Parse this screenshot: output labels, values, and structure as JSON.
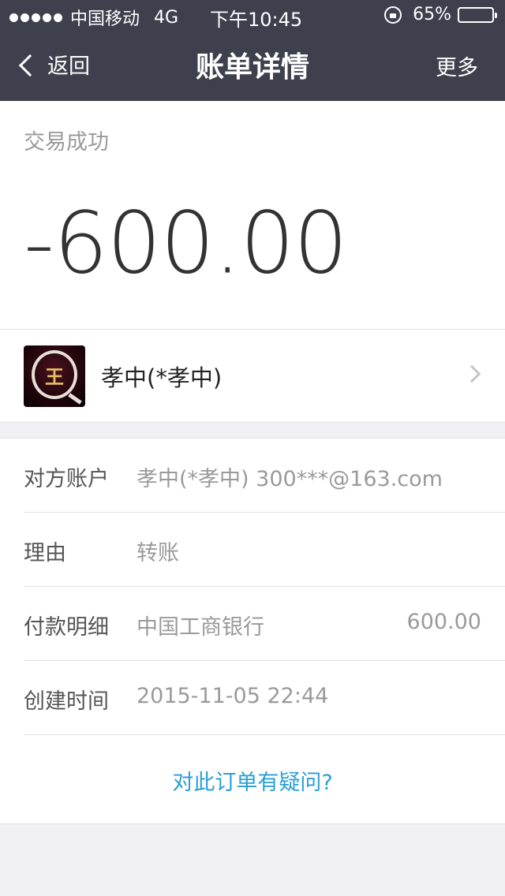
{
  "status_bar": {
    "carrier": "中国移动",
    "network": "4G",
    "time": "下午10:45",
    "battery_pct": "65%",
    "battery_level": 0.65
  },
  "nav": {
    "back_label": "返回",
    "title": "账单详情",
    "more_label": "更多"
  },
  "summary": {
    "status": "交易成功",
    "amount": "-600.00"
  },
  "party": {
    "avatar_glyph": "王",
    "name": "孝中(*孝中)"
  },
  "details": {
    "rows": [
      {
        "label": "对方账户",
        "value": "孝中(*孝中) 300***@163.com",
        "value_right": ""
      },
      {
        "label": "理由",
        "value": "转账",
        "value_right": ""
      },
      {
        "label": "付款明细",
        "value": "中国工商银行",
        "value_right": "600.00"
      },
      {
        "label": "创建时间",
        "value": "2015-11-05 22:44",
        "value_right": ""
      }
    ],
    "query_link": "对此订单有疑问?"
  },
  "colors": {
    "navbar_bg": "#3e414d",
    "link": "#2a9fd6",
    "page_bg": "#f0f0f5"
  }
}
